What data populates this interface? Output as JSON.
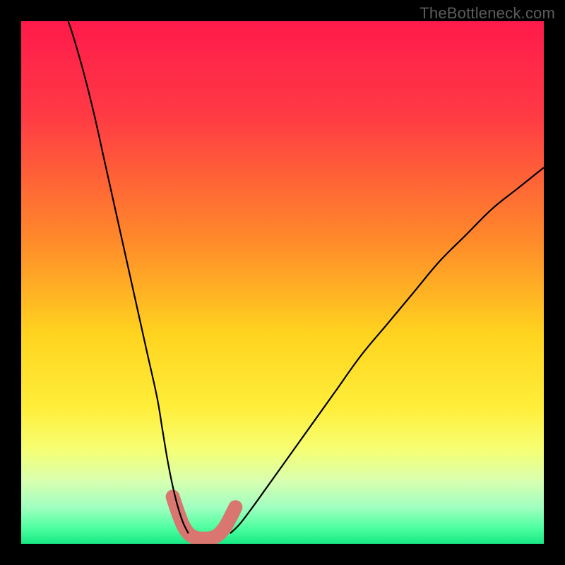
{
  "watermark": "TheBottleneck.com",
  "chart_data": {
    "type": "line",
    "title": "",
    "xlabel": "",
    "ylabel": "",
    "xlim": [
      0,
      100
    ],
    "ylim": [
      0,
      100
    ],
    "grid": false,
    "legend": null,
    "gradient_stops": [
      {
        "offset": 0,
        "color": "#ff1a4b"
      },
      {
        "offset": 18,
        "color": "#ff3a44"
      },
      {
        "offset": 42,
        "color": "#ff8a2a"
      },
      {
        "offset": 60,
        "color": "#ffd41f"
      },
      {
        "offset": 74,
        "color": "#ffee3a"
      },
      {
        "offset": 82,
        "color": "#f6ff73"
      },
      {
        "offset": 88,
        "color": "#d8ffb0"
      },
      {
        "offset": 93,
        "color": "#a0ffc0"
      },
      {
        "offset": 97,
        "color": "#4dffa0"
      },
      {
        "offset": 100,
        "color": "#17e884"
      }
    ],
    "series": [
      {
        "name": "left-curve",
        "stroke": "#000000",
        "x": [
          9,
          10,
          12,
          14,
          16,
          18,
          20,
          22,
          24,
          26,
          27,
          28,
          29,
          30,
          31,
          32
        ],
        "y": [
          100,
          97,
          90,
          82,
          73,
          64,
          55,
          46,
          37,
          28,
          22,
          16,
          11,
          7,
          4,
          2
        ]
      },
      {
        "name": "right-curve",
        "stroke": "#000000",
        "x": [
          40,
          42,
          45,
          50,
          55,
          60,
          65,
          70,
          75,
          80,
          85,
          90,
          95,
          100
        ],
        "y": [
          2,
          4,
          8,
          15,
          22,
          29,
          36,
          42,
          48,
          54,
          59,
          64,
          68,
          72
        ]
      },
      {
        "name": "highlight-band",
        "stroke": "#d9766f",
        "stroke_width": 20,
        "linecap": "round",
        "x": [
          29,
          30,
          31,
          32,
          33,
          34,
          35,
          36,
          37,
          38,
          39,
          40,
          41
        ],
        "y": [
          9,
          6,
          3.5,
          2,
          1.3,
          1,
          1,
          1,
          1.3,
          2,
          3.2,
          5,
          7
        ]
      }
    ]
  }
}
